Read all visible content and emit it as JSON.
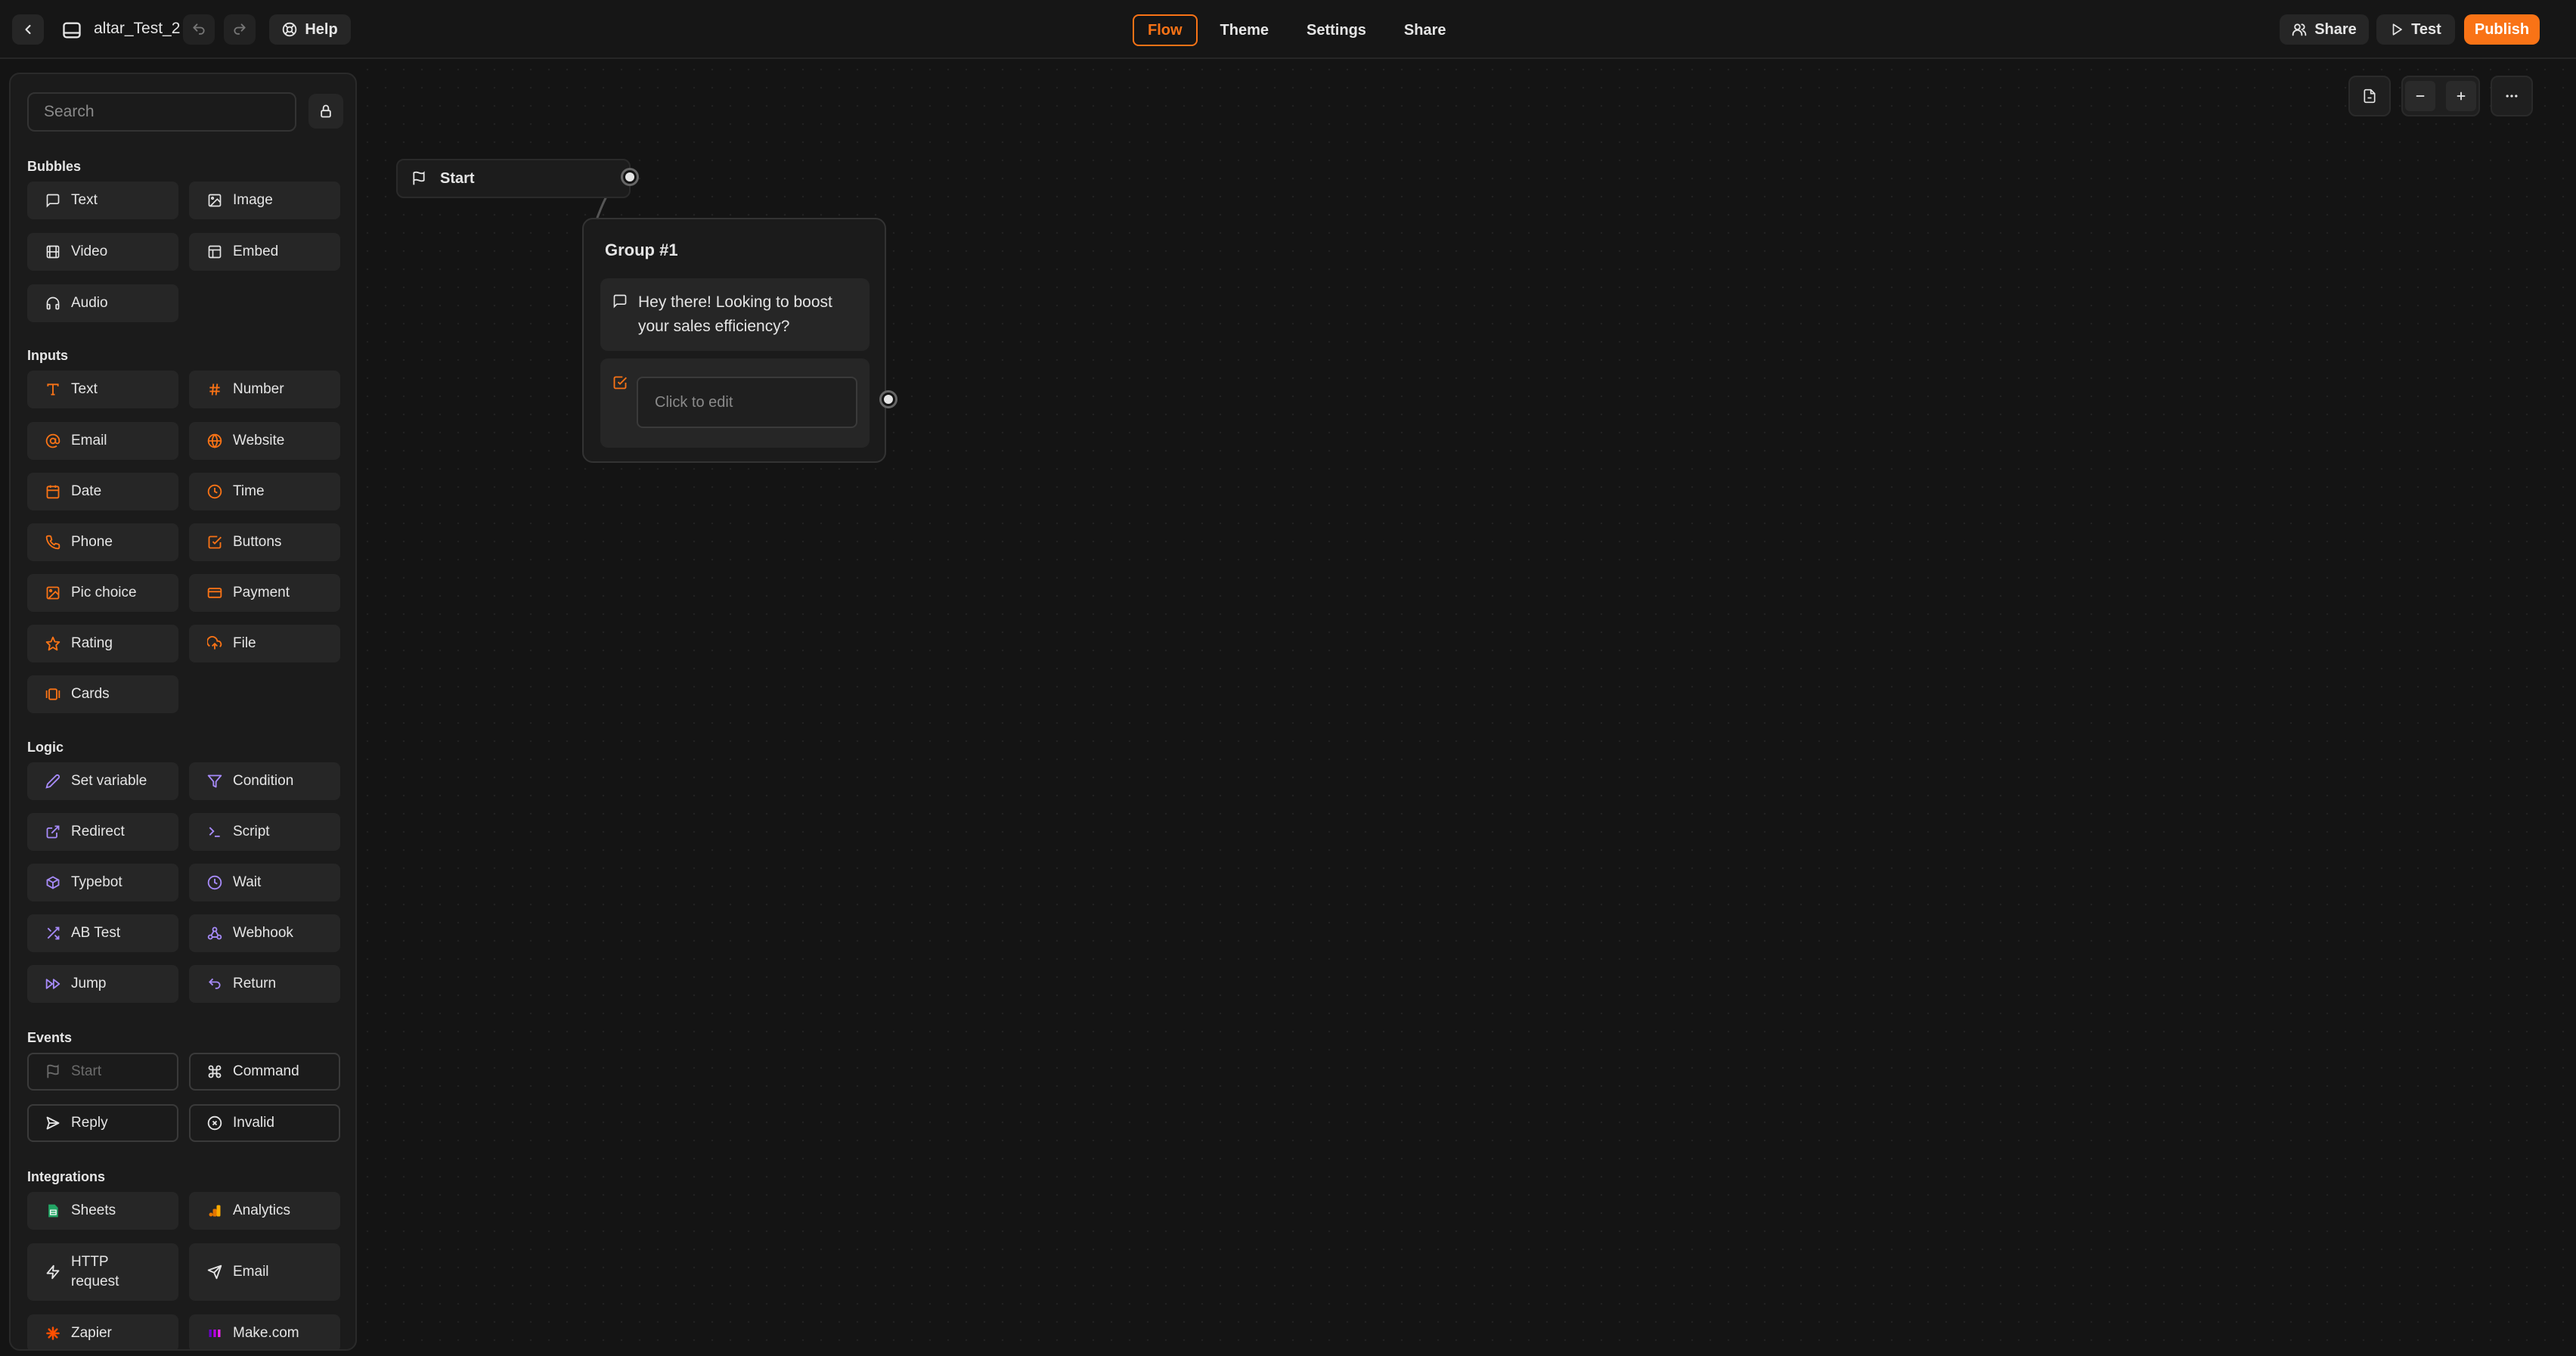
{
  "topbar": {
    "bot_name": "altar_Test_2",
    "help_label": "Help",
    "tabs": [
      {
        "label": "Flow",
        "active": true
      },
      {
        "label": "Theme",
        "active": false
      },
      {
        "label": "Settings",
        "active": false
      },
      {
        "label": "Share",
        "active": false
      }
    ],
    "share_label": "Share",
    "test_label": "Test",
    "publish_label": "Publish"
  },
  "sidebar": {
    "search_placeholder": "Search",
    "sections": {
      "bubbles": {
        "title": "Bubbles",
        "items": [
          {
            "label": "Text",
            "icon": "chat-bubble-icon"
          },
          {
            "label": "Image",
            "icon": "image-icon"
          },
          {
            "label": "Video",
            "icon": "film-icon"
          },
          {
            "label": "Embed",
            "icon": "layout-icon"
          },
          {
            "label": "Audio",
            "icon": "headphones-icon"
          }
        ]
      },
      "inputs": {
        "title": "Inputs",
        "items": [
          {
            "label": "Text",
            "icon": "text-cursor-icon"
          },
          {
            "label": "Number",
            "icon": "hash-icon"
          },
          {
            "label": "Email",
            "icon": "at-sign-icon"
          },
          {
            "label": "Website",
            "icon": "globe-icon"
          },
          {
            "label": "Date",
            "icon": "calendar-icon"
          },
          {
            "label": "Time",
            "icon": "clock-icon"
          },
          {
            "label": "Phone",
            "icon": "phone-icon"
          },
          {
            "label": "Buttons",
            "icon": "checkbox-icon"
          },
          {
            "label": "Pic choice",
            "icon": "image-choice-icon"
          },
          {
            "label": "Payment",
            "icon": "credit-card-icon"
          },
          {
            "label": "Rating",
            "icon": "star-icon"
          },
          {
            "label": "File",
            "icon": "cloud-upload-icon"
          },
          {
            "label": "Cards",
            "icon": "cards-icon"
          }
        ]
      },
      "logic": {
        "title": "Logic",
        "items": [
          {
            "label": "Set variable",
            "icon": "pencil-icon"
          },
          {
            "label": "Condition",
            "icon": "filter-icon"
          },
          {
            "label": "Redirect",
            "icon": "external-link-icon"
          },
          {
            "label": "Script",
            "icon": "terminal-icon"
          },
          {
            "label": "Typebot",
            "icon": "cube-icon"
          },
          {
            "label": "Wait",
            "icon": "clock-icon"
          },
          {
            "label": "AB Test",
            "icon": "shuffle-icon"
          },
          {
            "label": "Webhook",
            "icon": "webhook-icon"
          },
          {
            "label": "Jump",
            "icon": "fast-forward-icon"
          },
          {
            "label": "Return",
            "icon": "undo-icon"
          }
        ]
      },
      "events": {
        "title": "Events",
        "items": [
          {
            "label": "Start",
            "icon": "flag-icon"
          },
          {
            "label": "Command",
            "icon": "command-icon"
          },
          {
            "label": "Reply",
            "icon": "send-icon"
          },
          {
            "label": "Invalid",
            "icon": "x-circle-icon"
          }
        ]
      },
      "integrations": {
        "title": "Integrations",
        "items": [
          {
            "label": "Sheets",
            "icon": "google-sheets-icon"
          },
          {
            "label": "Analytics",
            "icon": "analytics-icon"
          },
          {
            "label": "HTTP request",
            "icon": "lightning-icon"
          },
          {
            "label": "Email",
            "icon": "send-icon"
          },
          {
            "label": "Zapier",
            "icon": "zapier-icon"
          },
          {
            "label": "Make.com",
            "icon": "make-icon"
          }
        ]
      }
    }
  },
  "canvas": {
    "start_label": "Start",
    "group": {
      "title": "Group #1",
      "message": "Hey there! Looking to boost your sales efficiency?",
      "input_placeholder": "Click to edit"
    }
  },
  "colors": {
    "accent": "#f97316",
    "logic": "#a78bfa",
    "background": "#141414"
  }
}
